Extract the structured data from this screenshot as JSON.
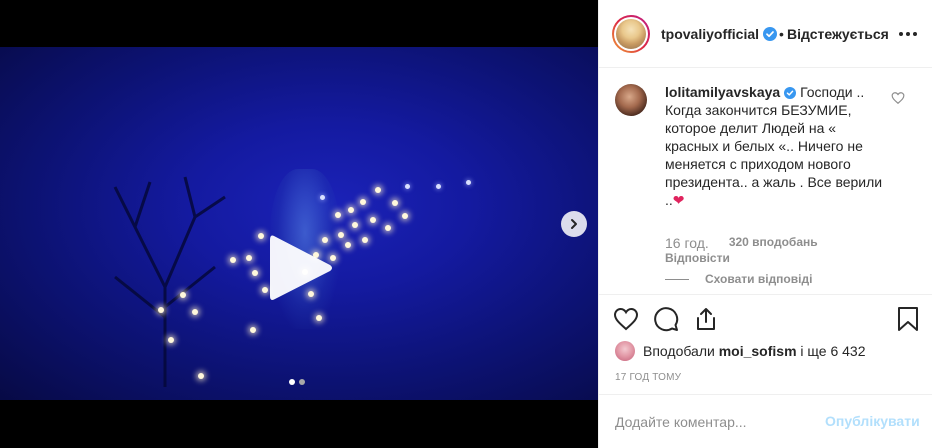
{
  "post": {
    "owner_username": "tpovaliyofficial",
    "follow_separator": "•",
    "follow_label": "Відстежується",
    "carousel": {
      "total_slides": 2,
      "active_slide": 1
    }
  },
  "comment": {
    "username": "lolitamilyavskaya",
    "text": "Господи .. Когда закончится БЕЗУМИЕ, которое делит Людей на « красных и белых «.. Ничего не меняется с приходом нового президента.. а жаль . Все верили ..",
    "emoji": "❤",
    "time": "16 год.",
    "likes": "320 вподобань",
    "reply_label": "Відповісти",
    "hide_replies_label": "Сховати відповіді"
  },
  "likes": {
    "prefix": "Вподобали",
    "user": "moi_sofism",
    "suffix": "і ще 6 432"
  },
  "timestamp": "17 ГОД ТОМУ",
  "composer": {
    "placeholder": "Додайте коментар...",
    "publish_label": "Опублікувати"
  },
  "colors": {
    "verified": "#3897f0",
    "publish_disabled": "#b2dffc",
    "video_blue": "#141aa0"
  },
  "icons": {
    "like": "heart-icon",
    "comment": "comment-icon",
    "share": "share-icon",
    "save": "bookmark-icon",
    "play": "play-icon",
    "next": "chevron-right-icon"
  }
}
